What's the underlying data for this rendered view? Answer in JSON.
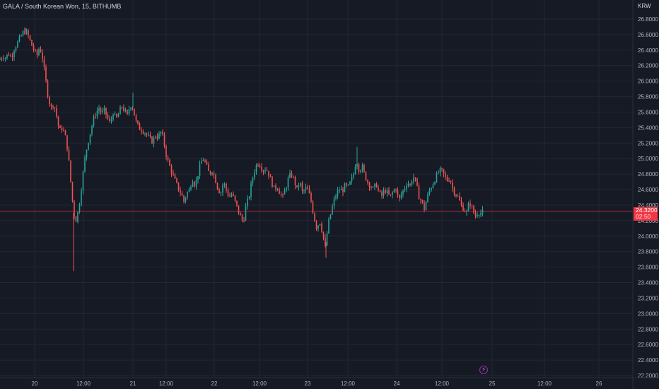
{
  "header": {
    "title": "GALA / South Korean Won, 15, BITHUMB",
    "currency": "KRW"
  },
  "colors": {
    "background": "#161a25",
    "up": "#26a69a",
    "down": "#ef5350",
    "grid": "#232733",
    "axis_text": "#b2b5be",
    "last_price_line": "#f23645"
  },
  "last_price": {
    "value": "24.3200",
    "countdown": "02:50",
    "numeric": 24.32
  },
  "events_icon": "lightning-icon",
  "chart_data": {
    "type": "candlestick",
    "title": "GALA / South Korean Won, 15, BITHUMB",
    "ylabel": "KRW",
    "ylim": [
      22.2,
      26.9
    ],
    "y_ticks": [
      "26.8000",
      "26.6000",
      "26.4000",
      "26.2000",
      "26.0000",
      "25.8000",
      "25.6000",
      "25.4000",
      "25.2000",
      "25.0000",
      "24.8000",
      "24.6000",
      "24.4000",
      "24.2000",
      "24.0000",
      "23.8000",
      "23.6000",
      "23.4000",
      "23.2000",
      "23.0000",
      "22.8000",
      "22.6000",
      "22.4000",
      "22.2000"
    ],
    "x_ticks": [
      "20",
      "12:00",
      "21",
      "12:00",
      "22",
      "12:00",
      "23",
      "12:00",
      "24",
      "12:00",
      "25",
      "12:00",
      "26"
    ],
    "grid": true,
    "price_path": [
      [
        0,
        26.28
      ],
      [
        4,
        26.33
      ],
      [
        8,
        26.3
      ],
      [
        12,
        26.36
      ],
      [
        16,
        26.3
      ],
      [
        20,
        26.42
      ],
      [
        24,
        26.48
      ],
      [
        28,
        26.55
      ],
      [
        32,
        26.62
      ],
      [
        36,
        26.65
      ],
      [
        40,
        26.58
      ],
      [
        44,
        26.48
      ],
      [
        48,
        26.4
      ],
      [
        52,
        26.32
      ],
      [
        56,
        26.45
      ],
      [
        60,
        26.3
      ],
      [
        64,
        26.05
      ],
      [
        68,
        25.8
      ],
      [
        72,
        25.65
      ],
      [
        76,
        25.72
      ],
      [
        80,
        25.55
      ],
      [
        84,
        25.35
      ],
      [
        88,
        25.4
      ],
      [
        92,
        25.3
      ],
      [
        96,
        25.1
      ],
      [
        100,
        24.7
      ],
      [
        104,
        24.3
      ],
      [
        108,
        24.2
      ],
      [
        112,
        24.4
      ],
      [
        116,
        24.7
      ],
      [
        120,
        25.0
      ],
      [
        124,
        25.2
      ],
      [
        128,
        25.35
      ],
      [
        132,
        25.5
      ],
      [
        136,
        25.6
      ],
      [
        140,
        25.65
      ],
      [
        144,
        25.58
      ],
      [
        148,
        25.62
      ],
      [
        152,
        25.52
      ],
      [
        156,
        25.45
      ],
      [
        160,
        25.6
      ],
      [
        164,
        25.5
      ],
      [
        168,
        25.58
      ],
      [
        172,
        25.68
      ],
      [
        176,
        25.62
      ],
      [
        180,
        25.55
      ],
      [
        184,
        25.7
      ],
      [
        188,
        25.66
      ],
      [
        192,
        25.48
      ],
      [
        196,
        25.4
      ],
      [
        200,
        25.38
      ],
      [
        204,
        25.35
      ],
      [
        208,
        25.3
      ],
      [
        212,
        25.25
      ],
      [
        216,
        25.22
      ],
      [
        220,
        25.3
      ],
      [
        224,
        25.28
      ],
      [
        228,
        25.35
      ],
      [
        232,
        25.2
      ],
      [
        236,
        25.0
      ],
      [
        240,
        24.9
      ],
      [
        244,
        24.8
      ],
      [
        248,
        24.7
      ],
      [
        252,
        24.62
      ],
      [
        256,
        24.55
      ],
      [
        260,
        24.45
      ],
      [
        264,
        24.55
      ],
      [
        268,
        24.6
      ],
      [
        272,
        24.75
      ],
      [
        276,
        24.65
      ],
      [
        280,
        24.8
      ],
      [
        284,
        24.95
      ],
      [
        288,
        25.0
      ],
      [
        292,
        24.9
      ],
      [
        296,
        24.8
      ],
      [
        300,
        24.85
      ],
      [
        304,
        24.75
      ],
      [
        308,
        24.62
      ],
      [
        312,
        24.55
      ],
      [
        316,
        24.7
      ],
      [
        320,
        24.6
      ],
      [
        324,
        24.5
      ],
      [
        328,
        24.55
      ],
      [
        332,
        24.45
      ],
      [
        336,
        24.35
      ],
      [
        340,
        24.25
      ],
      [
        344,
        24.18
      ],
      [
        348,
        24.4
      ],
      [
        352,
        24.5
      ],
      [
        356,
        24.7
      ],
      [
        360,
        24.85
      ],
      [
        364,
        24.95
      ],
      [
        368,
        24.92
      ],
      [
        372,
        24.85
      ],
      [
        376,
        24.88
      ],
      [
        380,
        24.8
      ],
      [
        384,
        24.7
      ],
      [
        388,
        24.6
      ],
      [
        392,
        24.65
      ],
      [
        396,
        24.55
      ],
      [
        400,
        24.5
      ],
      [
        404,
        24.62
      ],
      [
        408,
        24.75
      ],
      [
        412,
        24.8
      ],
      [
        416,
        24.72
      ],
      [
        420,
        24.6
      ],
      [
        424,
        24.7
      ],
      [
        428,
        24.55
      ],
      [
        432,
        24.62
      ],
      [
        436,
        24.58
      ],
      [
        440,
        24.45
      ],
      [
        444,
        24.25
      ],
      [
        448,
        24.1
      ],
      [
        452,
        24.2
      ],
      [
        456,
        24.05
      ],
      [
        460,
        23.85
      ],
      [
        464,
        24.15
      ],
      [
        468,
        24.3
      ],
      [
        472,
        24.45
      ],
      [
        476,
        24.55
      ],
      [
        480,
        24.6
      ],
      [
        484,
        24.58
      ],
      [
        488,
        24.65
      ],
      [
        492,
        24.62
      ],
      [
        496,
        24.7
      ],
      [
        500,
        24.8
      ],
      [
        504,
        25.0
      ],
      [
        508,
        24.85
      ],
      [
        512,
        24.9
      ],
      [
        516,
        24.78
      ],
      [
        520,
        24.7
      ],
      [
        524,
        24.65
      ],
      [
        528,
        24.6
      ],
      [
        532,
        24.68
      ],
      [
        536,
        24.55
      ],
      [
        540,
        24.52
      ],
      [
        544,
        24.6
      ],
      [
        548,
        24.55
      ],
      [
        552,
        24.5
      ],
      [
        556,
        24.58
      ],
      [
        560,
        24.62
      ],
      [
        564,
        24.45
      ],
      [
        568,
        24.55
      ],
      [
        572,
        24.62
      ],
      [
        576,
        24.7
      ],
      [
        580,
        24.65
      ],
      [
        584,
        24.78
      ],
      [
        588,
        24.7
      ],
      [
        592,
        24.52
      ],
      [
        596,
        24.45
      ],
      [
        600,
        24.35
      ],
      [
        604,
        24.5
      ],
      [
        608,
        24.6
      ],
      [
        612,
        24.68
      ],
      [
        616,
        24.75
      ],
      [
        620,
        24.82
      ],
      [
        624,
        24.85
      ],
      [
        628,
        24.78
      ],
      [
        632,
        24.72
      ],
      [
        636,
        24.75
      ],
      [
        640,
        24.62
      ],
      [
        644,
        24.55
      ],
      [
        648,
        24.5
      ],
      [
        652,
        24.4
      ],
      [
        656,
        24.35
      ],
      [
        660,
        24.3
      ],
      [
        664,
        24.45
      ],
      [
        668,
        24.35
      ],
      [
        672,
        24.25
      ],
      [
        676,
        24.32
      ],
      [
        680,
        24.3
      ],
      [
        684,
        24.32
      ]
    ],
    "spikes": [
      {
        "x": 104,
        "low": 23.55
      },
      {
        "x": 461,
        "low": 23.72
      },
      {
        "x": 505,
        "high": 25.15
      },
      {
        "x": 188,
        "high": 25.85
      },
      {
        "x": 36,
        "high": 26.68
      }
    ]
  }
}
